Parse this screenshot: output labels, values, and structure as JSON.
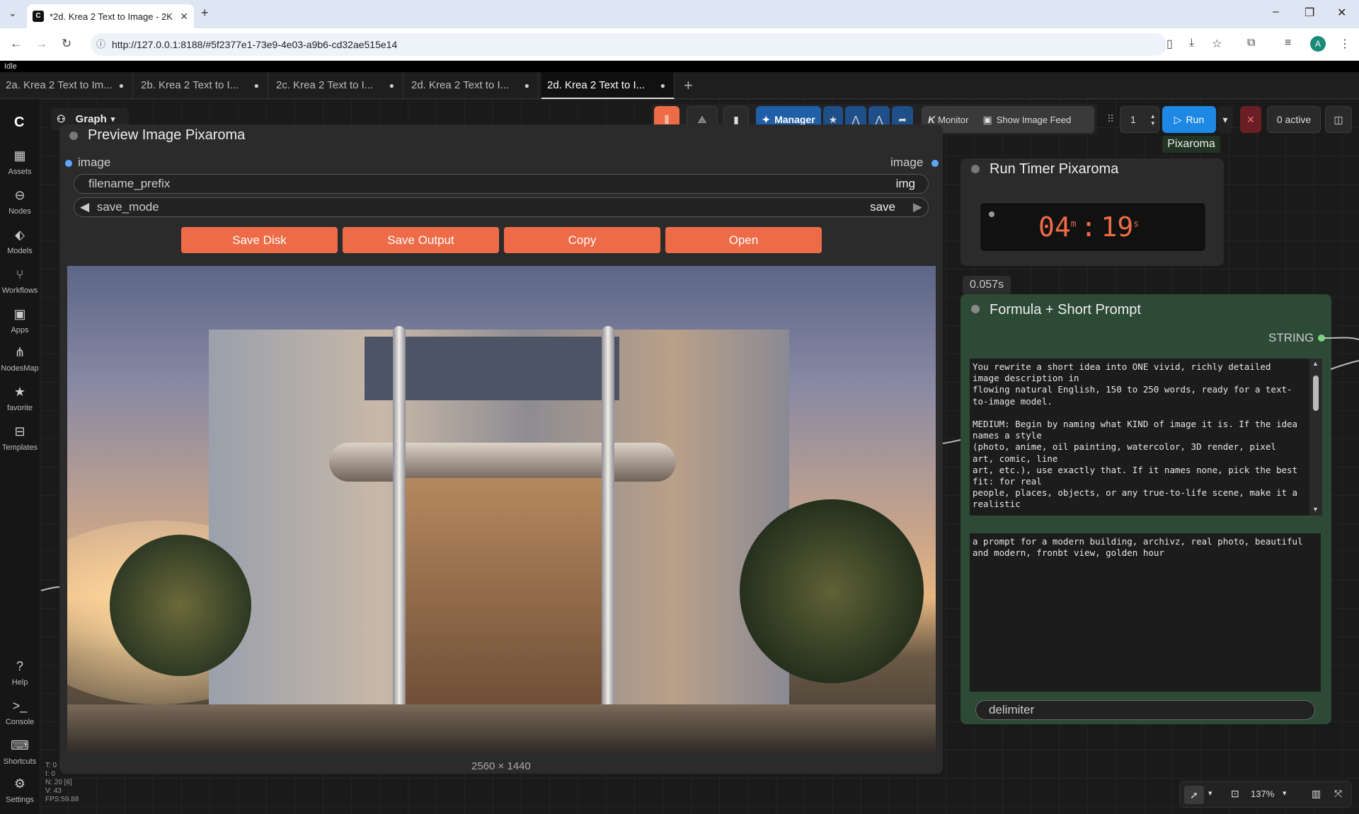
{
  "browser": {
    "tab_title": "*2d. Krea 2 Text to Image - 2K",
    "url": "http://127.0.0.1:8188/#5f2377e1-73e9-4e03-a9b6-cd32ae515e14",
    "profile_initial": "A"
  },
  "app": {
    "status": "Idle",
    "workflow_tabs": [
      {
        "label": "2a. Krea 2 Text to Im..."
      },
      {
        "label": "2b. Krea 2 Text to I..."
      },
      {
        "label": "2c. Krea 2 Text to I..."
      },
      {
        "label": "2d. Krea 2 Text to I..."
      },
      {
        "label": "2d. Krea 2 Text to I..."
      }
    ],
    "graph_label": "Graph",
    "sidebar": [
      {
        "label": "Assets",
        "icon": "assets-icon"
      },
      {
        "label": "Nodes",
        "icon": "nodes-icon"
      },
      {
        "label": "Models",
        "icon": "models-icon"
      },
      {
        "label": "Workflows",
        "icon": "workflows-icon"
      },
      {
        "label": "Apps",
        "icon": "apps-icon"
      },
      {
        "label": "NodesMap",
        "icon": "nodesmap-icon"
      },
      {
        "label": "favorite",
        "icon": "star-icon"
      },
      {
        "label": "Templates",
        "icon": "templates-icon"
      }
    ],
    "sidebar_bottom": [
      {
        "label": "Help",
        "icon": "help-icon"
      },
      {
        "label": "Console",
        "icon": "console-icon"
      },
      {
        "label": "Shortcuts",
        "icon": "keyboard-icon"
      },
      {
        "label": "Settings",
        "icon": "gear-icon"
      }
    ],
    "toolbar": {
      "manager": "Manager",
      "monitor": "Monitor",
      "show_image_feed": "Show Image Feed",
      "batch_count": "1",
      "run": "Run",
      "active": "0 active"
    },
    "stats": [
      "T: 0",
      "I: 0",
      "N: 20 [6]",
      "V: 43",
      "FPS:59.88"
    ],
    "zoom": "137%"
  },
  "preview_node": {
    "title": "Preview Image Pixaroma",
    "input_label": "image",
    "output_label": "image",
    "filename_prefix_label": "filename_prefix",
    "filename_prefix_value": "img",
    "save_mode_label": "save_mode",
    "save_mode_value": "save",
    "buttons": [
      "Save Disk",
      "Save Output",
      "Copy",
      "Open"
    ],
    "image_size": "2560 × 1440",
    "accent": "#ee6b47"
  },
  "timer_node": {
    "header_tag": "Pixaroma",
    "title": "Run Timer Pixaroma",
    "minutes": "04",
    "seconds": "19",
    "min_unit": "m",
    "sec_unit": "s",
    "separator": ":",
    "elapsed": "0.057s"
  },
  "formula_node": {
    "title": "Formula + Short Prompt",
    "output_label": "STRING",
    "system_text": "You rewrite a short idea into ONE vivid, richly detailed\nimage description in\nflowing natural English, 150 to 250 words, ready for a text-\nto-image model.\n\nMEDIUM: Begin by naming what KIND of image it is. If the idea\nnames a style\n(photo, anime, oil painting, watercolor, 3D render, pixel\nart, comic, line\nart, etc.), use exactly that. If it names none, pick the best\nfit: for real\npeople, places, objects, or any true-to-life scene, make it a\nrealistic",
    "prompt_text": "a prompt for a modern building, archivz, real photo, beautiful\nand modern, fronbt view, golden hour",
    "delimiter_label": "delimiter"
  }
}
